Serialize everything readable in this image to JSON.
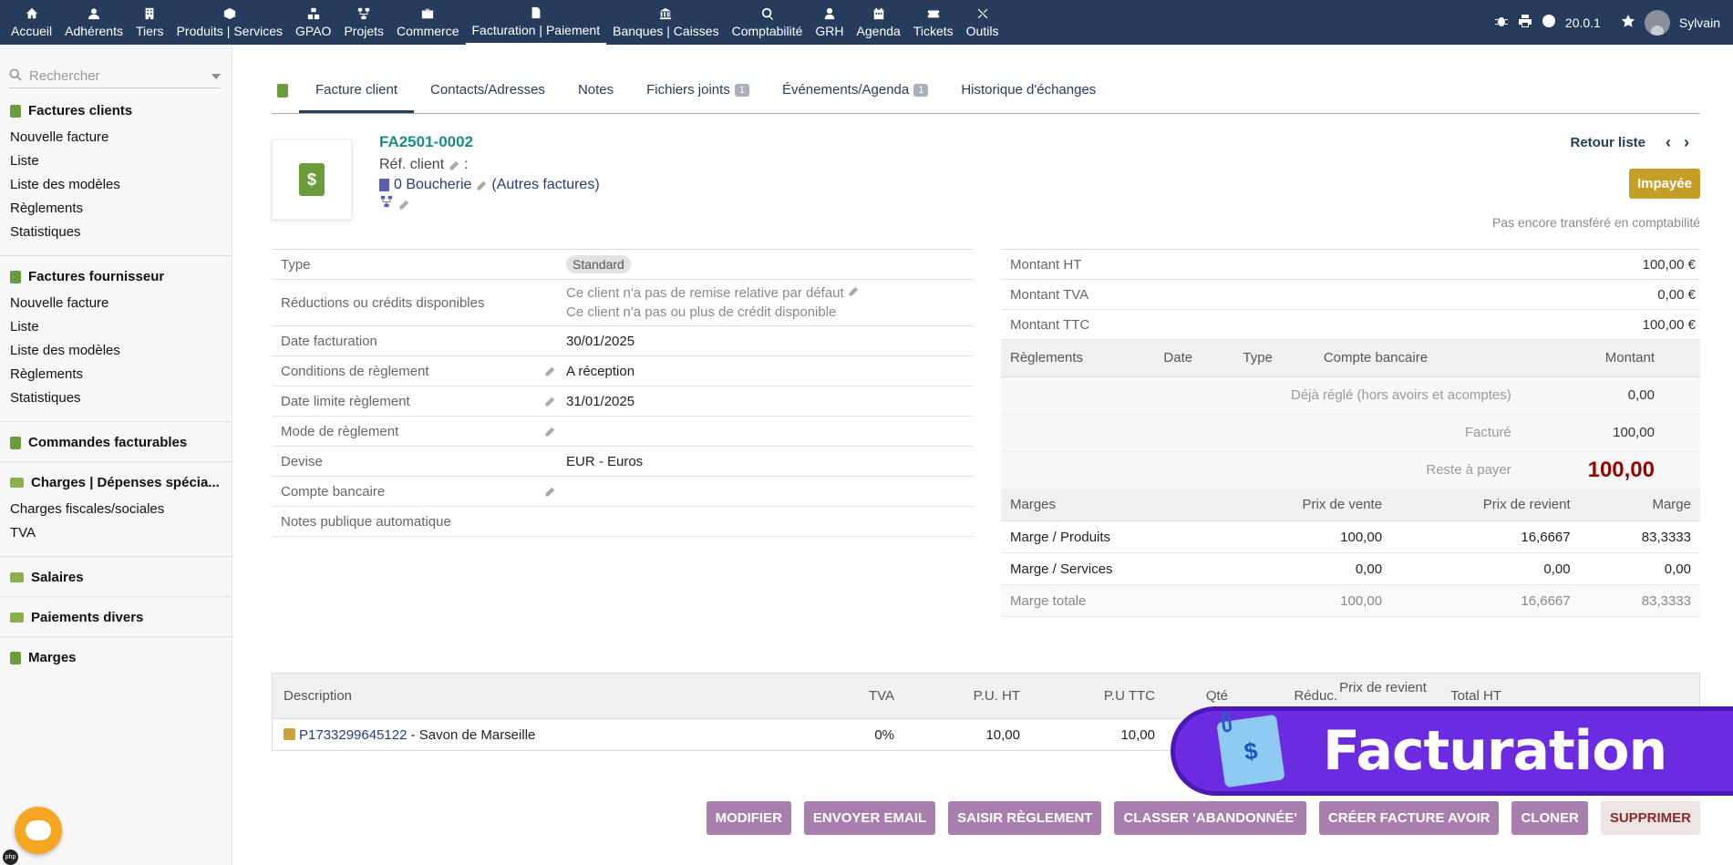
{
  "topbar": {
    "items": [
      {
        "label": "Accueil",
        "icon": "home-icon"
      },
      {
        "label": "Adhérents",
        "icon": "user-icon"
      },
      {
        "label": "Tiers",
        "icon": "building-icon"
      },
      {
        "label": "Produits | Services",
        "icon": "cube-icon"
      },
      {
        "label": "GPAO",
        "icon": "cubes-icon"
      },
      {
        "label": "Projets",
        "icon": "project-icon"
      },
      {
        "label": "Commerce",
        "icon": "briefcase-icon"
      },
      {
        "label": "Facturation | Paiement",
        "icon": "invoice-icon"
      },
      {
        "label": "Banques | Caisses",
        "icon": "bank-icon"
      },
      {
        "label": "Comptabilité",
        "icon": "search-dollar-icon"
      },
      {
        "label": "GRH",
        "icon": "user-tie-icon"
      },
      {
        "label": "Agenda",
        "icon": "calendar-icon"
      },
      {
        "label": "Tickets",
        "icon": "ticket-icon"
      },
      {
        "label": "Outils",
        "icon": "tools-icon"
      }
    ],
    "version": "20.0.1",
    "user": "Sylvain"
  },
  "sidebar": {
    "search_placeholder": "Rechercher",
    "groups": [
      {
        "title": "Factures clients",
        "items": [
          "Nouvelle facture",
          "Liste",
          "Liste des modèles",
          "Règlements",
          "Statistiques"
        ]
      },
      {
        "title": "Factures fournisseur",
        "items": [
          "Nouvelle facture",
          "Liste",
          "Liste des modèles",
          "Règlements",
          "Statistiques"
        ]
      },
      {
        "title": "Commandes facturables",
        "items": []
      },
      {
        "title": "Charges | Dépenses spécia...",
        "items": [
          "Charges fiscales/sociales",
          "TVA"
        ]
      },
      {
        "title": "Salaires",
        "items": []
      },
      {
        "title": "Paiements divers",
        "items": []
      },
      {
        "title": "Marges",
        "items": []
      }
    ]
  },
  "tabs": [
    {
      "label": "Facture client"
    },
    {
      "label": "Contacts/Adresses"
    },
    {
      "label": "Notes"
    },
    {
      "label": "Fichiers joints",
      "badge": "1"
    },
    {
      "label": "Événements/Agenda",
      "badge": "1"
    },
    {
      "label": "Historique d'échanges"
    }
  ],
  "invoice": {
    "ref": "FA2501-0002",
    "ref_client_label": "Réf. client",
    "ref_client_sep": ":",
    "thirdparty": "0 Boucherie",
    "other_invoices": "(Autres factures)",
    "back_list": "Retour liste",
    "status": "Impayée",
    "compta_status": "Pas encore transféré en comptabilité"
  },
  "fields": [
    {
      "label": "Type",
      "value": "Standard",
      "pill": true
    },
    {
      "label": "Réductions ou crédits disponibles",
      "value": "Ce client n'a pas de remise relative par défaut",
      "value2": "Ce client n'a pas ou plus de crédit disponible"
    },
    {
      "label": "Date facturation",
      "value": "30/01/2025"
    },
    {
      "label": "Conditions de règlement",
      "value": "A réception",
      "edit": true
    },
    {
      "label": "Date limite règlement",
      "value": "31/01/2025",
      "edit": true
    },
    {
      "label": "Mode de règlement",
      "value": "",
      "edit": true
    },
    {
      "label": "Devise",
      "value": "EUR - Euros"
    },
    {
      "label": "Compte bancaire",
      "value": "",
      "edit": true
    },
    {
      "label": "Notes publique automatique",
      "value": ""
    }
  ],
  "amounts": {
    "ht_label": "Montant HT",
    "ht": "100,00 €",
    "tva_label": "Montant TVA",
    "tva": "0,00 €",
    "ttc_label": "Montant TTC",
    "ttc": "100,00 €"
  },
  "payments": {
    "headers": [
      "Règlements",
      "Date",
      "Type",
      "Compte bancaire",
      "Montant"
    ],
    "deja_label": "Déjà réglé (hors avoirs et acomptes)",
    "deja": "0,00",
    "facture_label": "Facturé",
    "facture": "100,00",
    "reste_label": "Reste à payer",
    "reste": "100,00"
  },
  "margins": {
    "headers": [
      "Marges",
      "Prix de vente",
      "Prix de revient",
      "Marge"
    ],
    "rows": [
      [
        "Marge / Produits",
        "100,00",
        "16,6667",
        "83,3333"
      ],
      [
        "Marge / Services",
        "0,00",
        "0,00",
        "0,00"
      ],
      [
        "Marge totale",
        "100,00",
        "16,6667",
        "83,3333"
      ]
    ]
  },
  "lines": {
    "headers": [
      "Description",
      "TVA",
      "P.U. HT",
      "P.U TTC",
      "Qté",
      "Réduc.",
      "Prix de revient",
      "Total HT"
    ],
    "rows": [
      {
        "ref": "P1733299645122",
        "desc": " - Savon de Marseille",
        "tva": "0%",
        "pu_ht": "10,00",
        "pu_ttc": "10,00"
      }
    ]
  },
  "actions": [
    "MODIFIER",
    "ENVOYER EMAIL",
    "SAISIR RÈGLEMENT",
    "CLASSER 'ABANDONNÉE'",
    "CRÉER FACTURE AVOIR",
    "CLONER",
    "SUPPRIMER"
  ],
  "banner": {
    "text": "Facturation",
    "icon": "invoice-document-icon"
  },
  "colors": {
    "topbar": "#263c5c",
    "status": "#c59e28",
    "button": "#a87fac",
    "banner": "#6b2be0",
    "reste": "#990000"
  }
}
